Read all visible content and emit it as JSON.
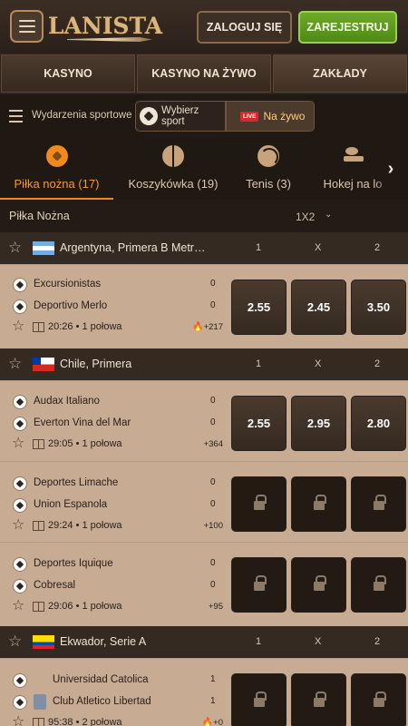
{
  "header": {
    "logo_text": "LANISTA",
    "login_label": "ZALOGUJ SIĘ",
    "register_label": "ZAREJESTRUJ"
  },
  "main_nav": [
    {
      "label": "KASYNO"
    },
    {
      "label": "KASYNO NA ŻYWO"
    },
    {
      "label": "ZAKŁADY",
      "active": true
    }
  ],
  "toolbar": {
    "sports_events_label": "Wydarzenia sportowe",
    "pick_sport_label": "Wybierz sport",
    "live_badge": "LIVE",
    "live_label": "Na żywo"
  },
  "sports_tabs": [
    {
      "label": "Piłka nożna (17)",
      "icon": "football-icon",
      "active": true
    },
    {
      "label": "Koszykówka (19)",
      "icon": "basketball-icon"
    },
    {
      "label": "Tenis (3)",
      "icon": "tennis-icon"
    },
    {
      "label": "Hokej na lo",
      "icon": "hockey-icon"
    }
  ],
  "list_header": {
    "title": "Piłka Nożna",
    "market": "1X2"
  },
  "odds_headers": {
    "home": "1",
    "draw": "X",
    "away": "2"
  },
  "leagues": [
    {
      "name": "Argentyna, Primera B Metr…",
      "flag": "argentina-flag",
      "matches": [
        {
          "home": "Excursionistas",
          "away": "Deportivo Merlo",
          "home_score": "0",
          "away_score": "0",
          "time": "20:26 • 1 połowa",
          "more": "+217",
          "hot": true,
          "odds": [
            "2.55",
            "2.45",
            "3.50"
          ],
          "locked": false
        }
      ]
    },
    {
      "name": "Chile, Primera",
      "flag": "chile-flag",
      "matches": [
        {
          "home": "Audax Italiano",
          "away": "Everton Vina del Mar",
          "home_score": "0",
          "away_score": "0",
          "time": "29:05 • 1 połowa",
          "more": "+364",
          "hot": false,
          "odds": [
            "2.55",
            "2.95",
            "2.80"
          ],
          "locked": false
        },
        {
          "home": "Deportes Limache",
          "away": "Union Espanola",
          "home_score": "0",
          "away_score": "0",
          "time": "29:24 • 1 połowa",
          "more": "+100",
          "hot": false,
          "odds": [
            "",
            "",
            ""
          ],
          "locked": true
        },
        {
          "home": "Deportes Iquique",
          "away": "Cobresal",
          "home_score": "0",
          "away_score": "0",
          "time": "29:06 • 1 połowa",
          "more": "+95",
          "hot": false,
          "odds": [
            "",
            "",
            ""
          ],
          "locked": true
        }
      ]
    },
    {
      "name": "Ekwador, Serie A",
      "flag": "ecuador-flag",
      "matches": [
        {
          "home": "Universidad Catolica",
          "away": "Club Atletico Libertad",
          "home_score": "1",
          "away_score": "1",
          "time": "95:38 • 2 połowa",
          "more": "+0",
          "hot": true,
          "odds": [
            "",
            "",
            ""
          ],
          "locked": true
        }
      ]
    }
  ],
  "colors": {
    "accent_orange": "#f08a1c",
    "register_green": "#5c9a1f",
    "odd_button": "#3f3126",
    "match_bg": "#c7ab93",
    "live_red": "#d8272e"
  }
}
